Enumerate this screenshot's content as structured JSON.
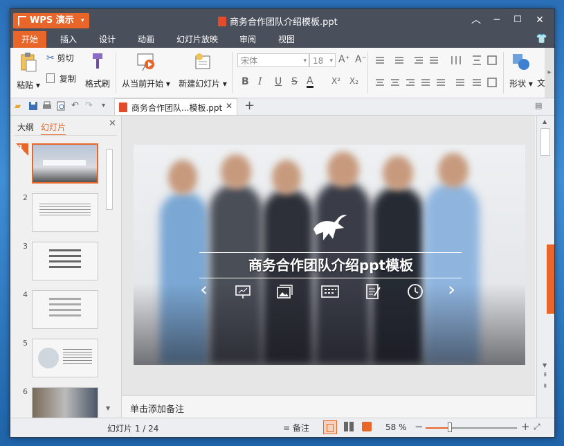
{
  "app": {
    "name": "WPS 演示",
    "menu_arrow": "▾"
  },
  "window": {
    "title": "商务合作团队介绍模板.ppt",
    "minimize": "︿",
    "restore": "─",
    "maximize": "☐",
    "close": "✕"
  },
  "tabs": [
    {
      "label": "开始",
      "active": true
    },
    {
      "label": "插入"
    },
    {
      "label": "设计"
    },
    {
      "label": "动画"
    },
    {
      "label": "幻灯片放映"
    },
    {
      "label": "审阅"
    },
    {
      "label": "视图"
    }
  ],
  "ribbon": {
    "paste": "粘贴",
    "cut": "剪切",
    "copy": "复制",
    "format_painter": "格式刷",
    "from_current": "从当前开始",
    "new_slide": "新建幻灯片",
    "font_name": "宋体",
    "font_size": "18",
    "bold": "B",
    "italic": "I",
    "underline": "U",
    "strike": "S",
    "font_color": "A",
    "superscript": "X²",
    "subscript": "X₂",
    "grow": "A⁺",
    "shrink": "A⁻",
    "shapes": "形状",
    "more": "文"
  },
  "quick": {
    "doc_tab": "商务合作团队...模板.ppt",
    "close_tab": "✕",
    "new_tab": "+"
  },
  "leftpane": {
    "tab_outline": "大纲",
    "tab_slides": "幻灯片",
    "close": "✕",
    "thumbs": [
      "1",
      "2",
      "3",
      "4",
      "5",
      "6"
    ]
  },
  "slide": {
    "title": "商务合作团队介绍ppt模板",
    "prev": "‹",
    "next": "›"
  },
  "notes": {
    "placeholder": "单击添加备注"
  },
  "status": {
    "slide_info": "幻灯片 1 / 24",
    "notes_btn": "备注",
    "zoom": "58 %",
    "zoom_level": 0.58,
    "zoom_minus": "−",
    "zoom_plus": "+"
  },
  "colors": {
    "accent": "#e8662a",
    "titlebar": "#4a4f5c"
  }
}
